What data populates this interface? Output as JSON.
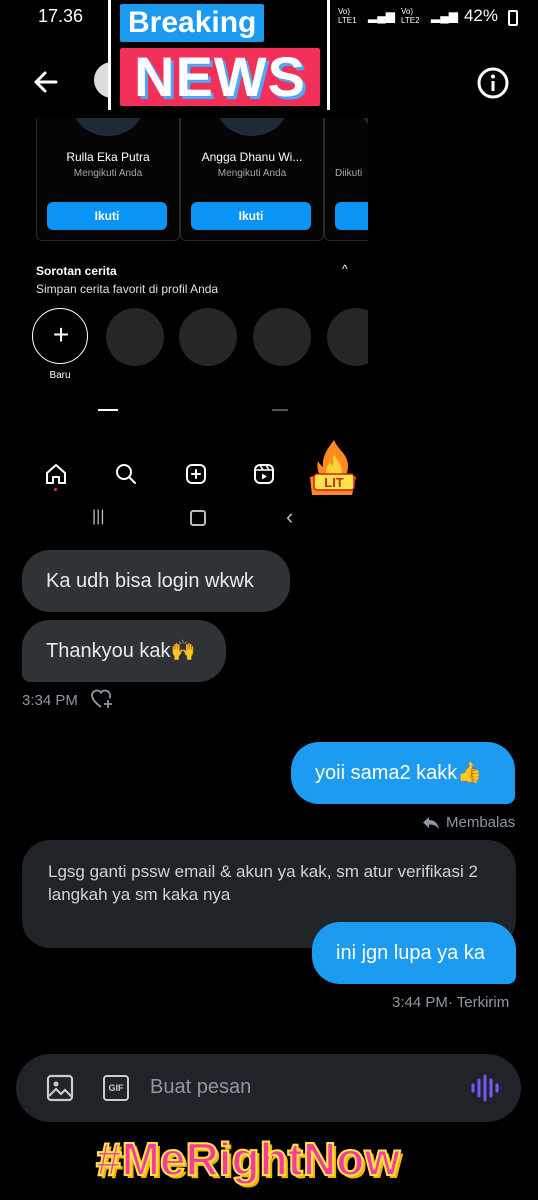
{
  "status_bar": {
    "time": "17.36",
    "battery": "42%",
    "network_label_1": "Vo) LTE1",
    "network_label_2": "Vo) LTE2"
  },
  "stickers": {
    "breaking": "Breaking",
    "news": "NEWS",
    "lit": "LIT",
    "hashtag": "#MeRightNow"
  },
  "embedded_profile": {
    "suggestions": [
      {
        "name": "Rulla Eka Putra",
        "sub": "Mengikuti Anda",
        "button": "Ikuti"
      },
      {
        "name": "Angga Dhanu Wi...",
        "sub": "Mengikuti Anda",
        "button": "Ikuti"
      },
      {
        "name": "",
        "sub": "Diikuti",
        "button": ""
      }
    ],
    "highlights_title": "Sorotan cerita",
    "highlights_sub": "Simpan cerita favorit di profil Anda",
    "highlights_new_label": "Baru"
  },
  "chat": {
    "messages": [
      {
        "dir": "in",
        "text": "Ka udh bisa login wkwk"
      },
      {
        "dir": "in",
        "text": "Thankyou kak🙌"
      },
      {
        "dir": "out",
        "text": "yoii sama2 kakk👍"
      },
      {
        "dir": "in",
        "text": "Lgsg ganti pssw email & akun ya kak, sm atur verifikasi 2 langkah ya sm kaka nya"
      },
      {
        "dir": "out",
        "text": "ini jgn lupa ya ka"
      }
    ],
    "time_1": "3:34 PM",
    "reply_label": "Membalas",
    "time_2": "3:44 PM",
    "sent_status": "· Terkirim"
  },
  "compose": {
    "placeholder": "Buat pesan",
    "gif_label": "GIF"
  },
  "colors": {
    "accent_blue": "#1d9bf0",
    "incoming_bubble": "#2f3336",
    "voice_purple": "#7856ff"
  }
}
